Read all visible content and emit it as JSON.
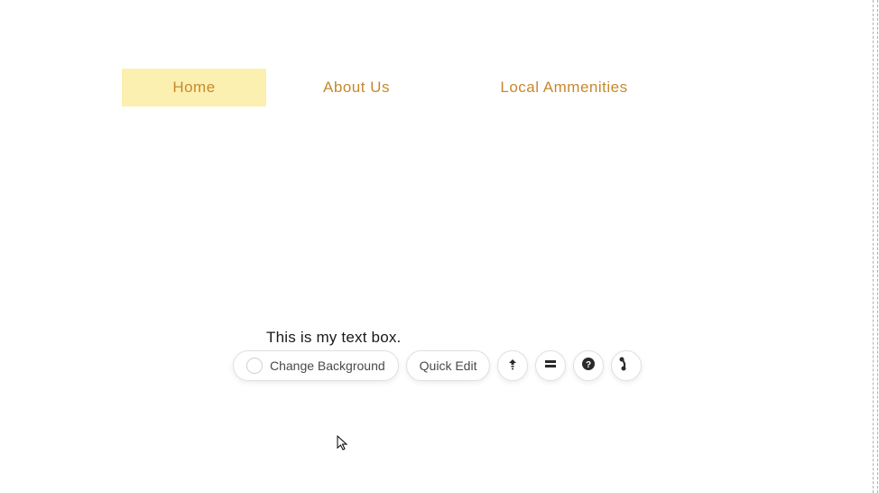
{
  "nav": {
    "items": [
      {
        "label": "Home",
        "active": true
      },
      {
        "label": "About Us",
        "active": false
      },
      {
        "label": "Local Ammenities",
        "active": false
      }
    ]
  },
  "textbox": {
    "content": "This is my text box."
  },
  "toolbar": {
    "change_background_label": "Change Background",
    "quick_edit_label": "Quick Edit"
  }
}
